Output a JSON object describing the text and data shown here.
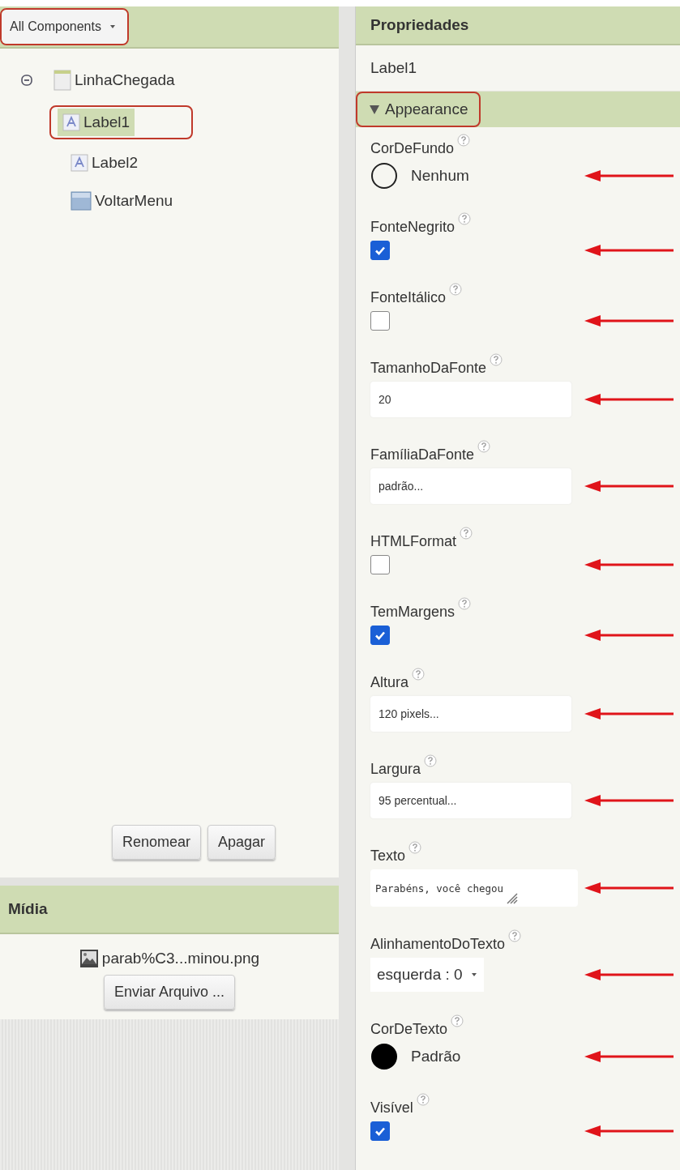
{
  "components_panel": {
    "filter_button": {
      "label": "All Components",
      "highlighted": true
    },
    "tree": [
      {
        "name": "LinhaChegada",
        "kind": "arrangement",
        "expanded": true,
        "selected": false,
        "highlighted": false,
        "children": [
          {
            "name": "Label1",
            "kind": "label",
            "selected": true,
            "highlighted": true
          },
          {
            "name": "Label2",
            "kind": "label",
            "selected": false,
            "highlighted": false
          },
          {
            "name": "VoltarMenu",
            "kind": "button",
            "selected": false,
            "highlighted": false
          }
        ]
      }
    ],
    "buttons": [
      "Renomear",
      "Apagar"
    ]
  },
  "media_panel": {
    "title": "Mídia",
    "files": [
      "parab%C3...minou.png"
    ],
    "upload_button": "Enviar Arquivo ..."
  },
  "properties_panel": {
    "title": "Propriedades",
    "component": "Label1",
    "section": {
      "title": "Appearance",
      "expanded": true,
      "highlighted": true
    },
    "properties": [
      {
        "kind": "color",
        "name": "CorDeFundo",
        "value": "Nenhum"
      },
      {
        "kind": "checkbox",
        "name": "FonteNegrito",
        "checked": true
      },
      {
        "kind": "checkbox",
        "name": "FonteItálico",
        "checked": false
      },
      {
        "kind": "text",
        "name": "TamanhoDaFonte",
        "value": "20"
      },
      {
        "kind": "text",
        "name": "FamíliaDaFonte",
        "value": "padrão..."
      },
      {
        "kind": "checkbox",
        "name": "HTMLFormat",
        "checked": false
      },
      {
        "kind": "checkbox",
        "name": "TemMargens",
        "checked": true
      },
      {
        "kind": "text",
        "name": "Altura",
        "value": "120 pixels..."
      },
      {
        "kind": "text",
        "name": "Largura",
        "value": "95 percentual..."
      },
      {
        "kind": "textarea",
        "name": "Texto",
        "value": "Parabéns, você chegou"
      },
      {
        "kind": "dropdown",
        "name": "AlinhamentoDoTexto",
        "value": "esquerda : 0"
      },
      {
        "kind": "color",
        "name": "CorDeTexto",
        "value": "Padrão",
        "color": "#000000"
      },
      {
        "kind": "checkbox",
        "name": "Visível",
        "checked": true
      }
    ]
  }
}
